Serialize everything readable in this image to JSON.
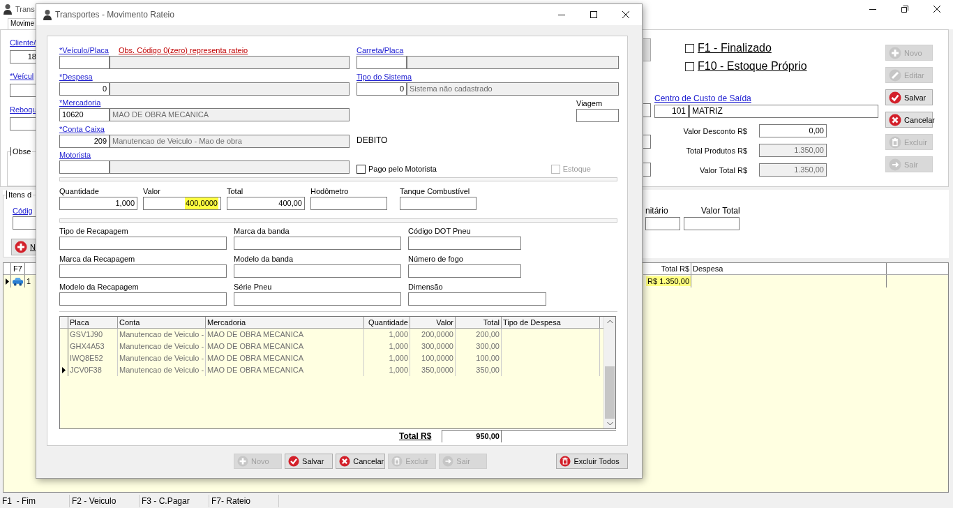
{
  "main_window": {
    "title": "Trans",
    "tab": {
      "label": "Movime",
      "selected": true
    },
    "left_fields": [
      {
        "label": "Cliente/",
        "value": "18"
      },
      {
        "label": "*Veícul"
      },
      {
        "label": "Reboqu"
      }
    ],
    "observations_label": "Obse",
    "flags": [
      {
        "label": "F1 - Finalizado",
        "checked": false
      },
      {
        "label": "F10 - Estoque Próprio",
        "checked": false
      }
    ],
    "cost_center": {
      "label": "Centro de Custo de Saída",
      "code": "101",
      "name": "MATRIZ"
    },
    "totals": [
      {
        "label": "Valor Desconto R$",
        "value": "0,00",
        "disabled": false
      },
      {
        "label": "Total Produtos R$",
        "value": "1.350,00",
        "disabled": true
      },
      {
        "label": "Valor Total R$",
        "value": "1.350,00",
        "disabled": true
      }
    ],
    "actions": [
      {
        "label": "Novo",
        "disabled": true
      },
      {
        "label": "Editar",
        "disabled": true
      },
      {
        "label": "Salvar",
        "disabled": false
      },
      {
        "label": "Cancelar",
        "disabled": false
      },
      {
        "label": "Excluir",
        "disabled": true
      },
      {
        "label": "Sair",
        "disabled": true
      }
    ],
    "items": {
      "title": "Itens d",
      "code_label": "Códig",
      "add_button": {
        "label": "N",
        "disabled": false
      },
      "price_labels": [
        "nitário",
        "Valor Total"
      ]
    },
    "grid": {
      "columns": [
        "F7",
        "Total R$",
        "Despesa"
      ],
      "rows": [
        {
          "selected": true,
          "number": "1",
          "total": "R$ 1.350,00"
        }
      ]
    },
    "status_bar": [
      "F1  - Fim",
      "F2 - Veiculo",
      "F3 - C.Pagar",
      "F7- Rateio"
    ]
  },
  "dialog": {
    "title": "Transportes - Movimento Rateio",
    "form_rows": [
      {
        "left": {
          "label": "*Veículo/Placa",
          "note": "Obs. Código 0(zero) representa rateio"
        },
        "right": {
          "kind": "lookup",
          "label": "Carreta/Placa"
        }
      },
      {
        "left": {
          "label": "*Despesa",
          "code": "0"
        },
        "right": {
          "kind": "lookup",
          "label": "Tipo do Sistema",
          "code": "0",
          "desc": "Sistema não cadastrado"
        }
      },
      {
        "left": {
          "label": "*Mercadoria",
          "code": "10620",
          "desc": "MAO DE OBRA MECANICA"
        },
        "right": {
          "kind": "field",
          "label": "Viagem"
        }
      },
      {
        "left": {
          "label": "*Conta Caixa",
          "code": "209",
          "desc": "Manutencao de Veiculo - Mao de obra"
        },
        "right": {
          "kind": "text",
          "text": "DEBITO"
        }
      },
      {
        "left": {
          "label": "Motorista"
        },
        "right": {
          "kind": "checks",
          "items": [
            {
              "label": "Pago pelo Motorista",
              "checked": false,
              "disabled": false
            },
            {
              "label": "Estoque",
              "checked": false,
              "disabled": true
            }
          ]
        }
      }
    ],
    "values": [
      {
        "label": "Quantidade",
        "value": "1,000",
        "highlighted": false
      },
      {
        "label": "Valor",
        "value": "400,0000",
        "highlighted": true
      },
      {
        "label": "Total",
        "value": "400,00",
        "highlighted": false
      },
      {
        "label": "Hodômetro"
      },
      {
        "label": "Tanque Combustível"
      }
    ],
    "tire_fields": [
      {
        "label": "Tipo de Recapagem"
      },
      {
        "label": "Marca da banda"
      },
      {
        "label": "Código DOT Pneu"
      },
      {
        "label": "Marca da Recapagem"
      },
      {
        "label": "Modelo da banda"
      },
      {
        "label": "Número de fogo"
      },
      {
        "label": "Modelo da Recapagem"
      },
      {
        "label": "Série Pneu"
      },
      {
        "label": "Dimensão"
      }
    ],
    "table": {
      "columns": [
        "Placa",
        "Conta",
        "Mercadoria",
        "Quantidade",
        "Valor",
        "Total",
        "Tipo de Despesa"
      ],
      "rows": [
        {
          "selected": false,
          "cells": [
            "GSV1J90",
            "Manutencao de Veiculo -",
            "MAO DE OBRA MECANICA",
            "1,000",
            "200,0000",
            "200,00"
          ]
        },
        {
          "selected": false,
          "cells": [
            "GHX4A53",
            "Manutencao de Veiculo -",
            "MAO DE OBRA MECANICA",
            "1,000",
            "300,0000",
            "300,00"
          ]
        },
        {
          "selected": false,
          "cells": [
            "IWQ8E52",
            "Manutencao de Veiculo -",
            "MAO DE OBRA MECANICA",
            "1,000",
            "100,0000",
            "100,00"
          ]
        },
        {
          "selected": true,
          "cells": [
            "JCV0F38",
            "Manutencao de Veiculo -",
            "MAO DE OBRA MECANICA",
            "1,000",
            "350,0000",
            "350,00"
          ]
        }
      ],
      "total_label": "Total R$",
      "total": "950,00"
    },
    "buttons": [
      {
        "label": "Novo",
        "disabled": true
      },
      {
        "label": "Salvar",
        "disabled": false
      },
      {
        "label": "Cancelar",
        "disabled": false
      },
      {
        "label": "Excluir",
        "disabled": true
      },
      {
        "label": "Sair",
        "disabled": true
      },
      {
        "label": "Excluir Todos",
        "disabled": false
      }
    ]
  }
}
